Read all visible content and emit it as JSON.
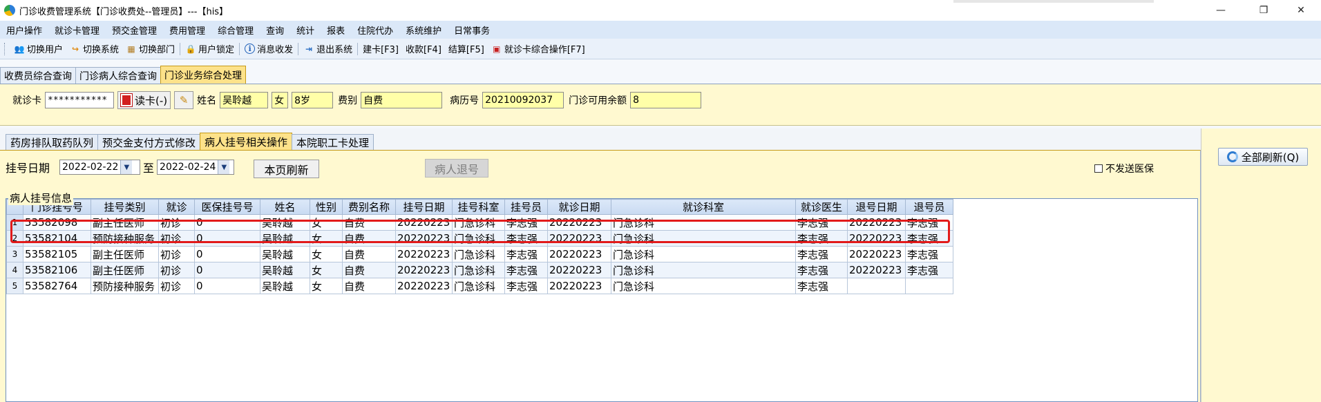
{
  "window": {
    "title": "门诊收费管理系统【门诊收费处--管理员】---【his】",
    "minimize": "—",
    "maximize": "❐",
    "close": "✕"
  },
  "menu": [
    "用户操作",
    "就诊卡管理",
    "预交金管理",
    "费用管理",
    "综合管理",
    "查询",
    "统计",
    "报表",
    "住院代办",
    "系统维护",
    "日常事务"
  ],
  "toolbar": [
    {
      "name": "switch-user",
      "icon": "👥",
      "label": "切换用户"
    },
    {
      "name": "switch-system",
      "icon": "↪",
      "label": "切换系统"
    },
    {
      "name": "switch-dept",
      "icon": "▦",
      "label": "切换部门"
    },
    {
      "name": "lock-user",
      "icon": "🔒",
      "label": "用户锁定"
    },
    {
      "name": "message",
      "icon": "ℹ",
      "label": "消息收发"
    },
    {
      "name": "exit-system",
      "icon": "⇥",
      "label": "退出系统"
    },
    {
      "name": "create-card",
      "icon": "",
      "label": "建卡[F3]"
    },
    {
      "name": "charge",
      "icon": "",
      "label": "收款[F4]"
    },
    {
      "name": "settle",
      "icon": "",
      "label": "结算[F5]"
    },
    {
      "name": "card-combined",
      "icon": "▣",
      "label": "就诊卡综合操作[F7]"
    }
  ],
  "outer_tabs": [
    "收费员综合查询",
    "门诊病人综合查询",
    "门诊业务综合处理"
  ],
  "patient": {
    "card_label": "就诊卡",
    "card_value": "***********",
    "read_card": "读卡(-)",
    "name_label": "姓名",
    "name": "吴聆越",
    "gender": "女",
    "age": "8岁",
    "fee_type_label": "费别",
    "fee_type": "自费",
    "record_label": "病历号",
    "record_no": "20210092037",
    "balance_label": "门诊可用余额",
    "balance": "8"
  },
  "inner_tabs": [
    "药房排队取药队列",
    "预交金支付方式修改",
    "病人挂号相关操作",
    "本院职工卡处理"
  ],
  "filter": {
    "date_label": "挂号日期",
    "start_date": "2022-02-22",
    "to_label": "至",
    "end_date": "2022-02-24",
    "refresh_page": "本页刷新",
    "unregister": "病人退号",
    "no_insurance": "不发送医保",
    "refresh_all": "全部刷新(Q)"
  },
  "grid": {
    "group_label": "病人挂号信息",
    "columns": [
      "",
      "门诊挂号号",
      "挂号类别",
      "就诊",
      "医保挂号号",
      "姓名",
      "性别",
      "费别名称",
      "挂号日期",
      "挂号科室",
      "挂号员",
      "就诊日期",
      "就诊科室",
      "就诊医生",
      "退号日期",
      "退号员"
    ],
    "rows": [
      [
        "1",
        "53582098",
        "副主任医师",
        "初诊",
        "0",
        "吴聆越",
        "女",
        "自费",
        "20220223",
        "门急诊科",
        "李志强",
        "20220223",
        "门急诊科",
        "李志强",
        "20220223",
        "李志强"
      ],
      [
        "2",
        "53582104",
        "预防接种服务",
        "初诊",
        "0",
        "吴聆越",
        "女",
        "自费",
        "20220223",
        "门急诊科",
        "李志强",
        "20220223",
        "门急诊科",
        "李志强",
        "20220223",
        "李志强"
      ],
      [
        "3",
        "53582105",
        "副主任医师",
        "初诊",
        "0",
        "吴聆越",
        "女",
        "自费",
        "20220223",
        "门急诊科",
        "李志强",
        "20220223",
        "门急诊科",
        "李志强",
        "20220223",
        "李志强"
      ],
      [
        "4",
        "53582106",
        "副主任医师",
        "初诊",
        "0",
        "吴聆越",
        "女",
        "自费",
        "20220223",
        "门急诊科",
        "李志强",
        "20220223",
        "门急诊科",
        "李志强",
        "20220223",
        "李志强"
      ],
      [
        "5",
        "53582764",
        "预防接种服务",
        "初诊",
        "0",
        "吴聆越",
        "女",
        "自费",
        "20220223",
        "门急诊科",
        "李志强",
        "20220223",
        "门急诊科",
        "李志强",
        "",
        ""
      ]
    ]
  },
  "colors": {
    "highlight": "#e21a1a",
    "active_tab": "#fde28a",
    "panel_bg": "#fff9d0",
    "field_bg": "#ffffa8"
  }
}
